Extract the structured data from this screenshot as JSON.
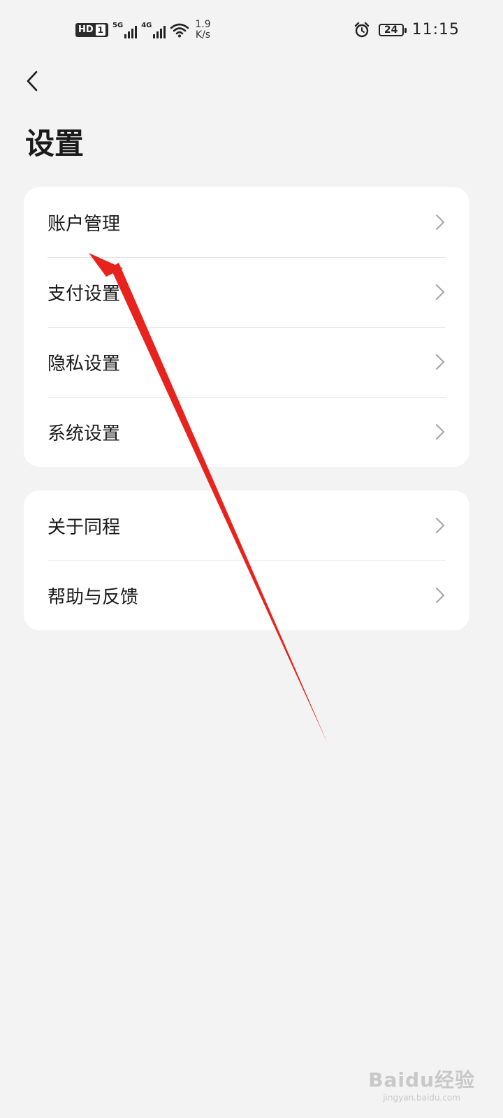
{
  "status_bar": {
    "hd": "HD",
    "sim": "1",
    "net1": "5G",
    "net2": "4G",
    "speed_value": "1.9",
    "speed_unit": "K/s",
    "battery": "24",
    "time": "11:15"
  },
  "page": {
    "title": "设置"
  },
  "group1": {
    "items": [
      {
        "label": "账户管理"
      },
      {
        "label": "支付设置"
      },
      {
        "label": "隐私设置"
      },
      {
        "label": "系统设置"
      }
    ]
  },
  "group2": {
    "items": [
      {
        "label": "关于同程"
      },
      {
        "label": "帮助与反馈"
      }
    ]
  },
  "annotation": {
    "arrow_color": "#e8231d"
  },
  "watermark": {
    "main": "Baidu经验",
    "sub": "jingyan.baidu.com"
  }
}
